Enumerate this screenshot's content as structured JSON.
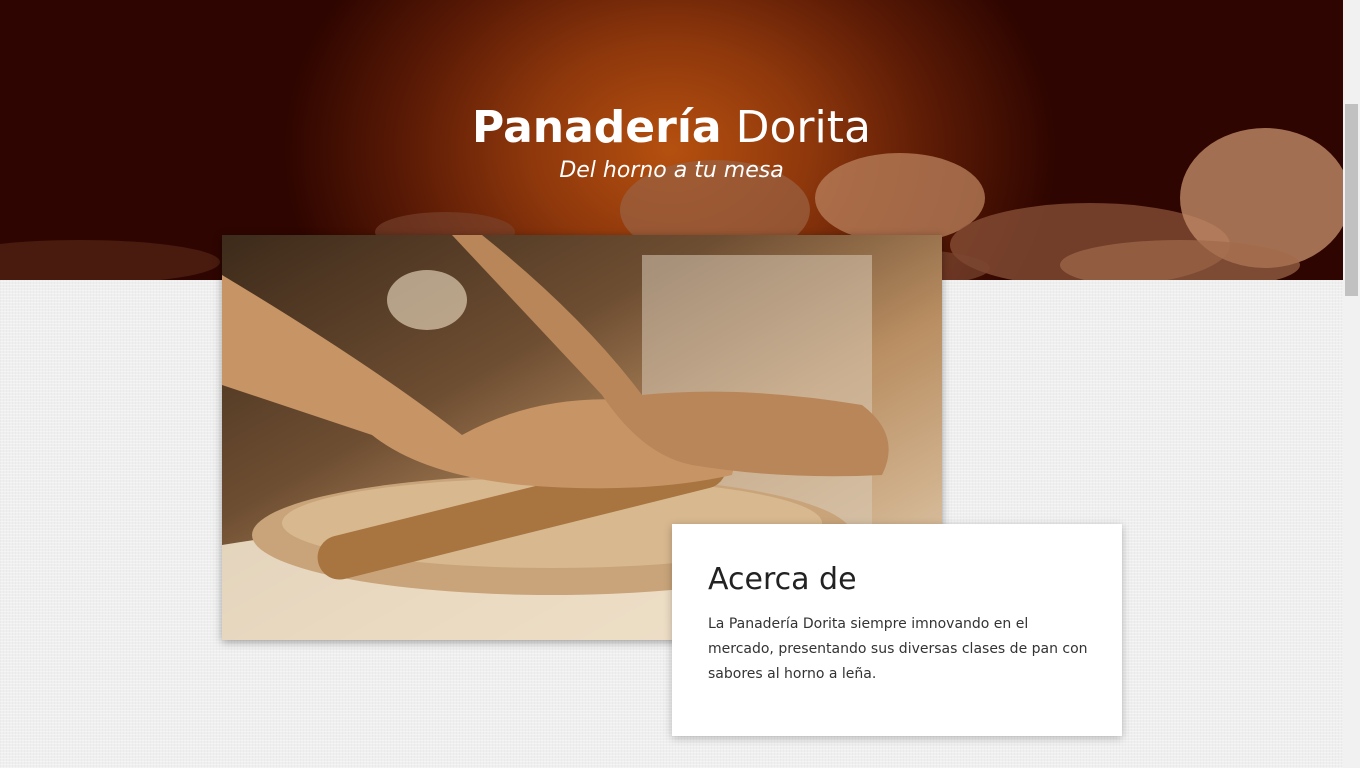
{
  "hero": {
    "title_bold": "Panadería",
    "title_light": "Dorita",
    "subtitle": "Del horno a tu mesa"
  },
  "about": {
    "heading": "Acerca de",
    "text": "La Panadería Dorita siempre imnovando en el mercado, presentando sus diversas clases de pan con sabores al horno a leña."
  },
  "colors": {
    "hero_center": "#b5500f",
    "hero_edge": "#2e0500",
    "page_bg": "#efefef",
    "card_bg": "#ffffff"
  }
}
